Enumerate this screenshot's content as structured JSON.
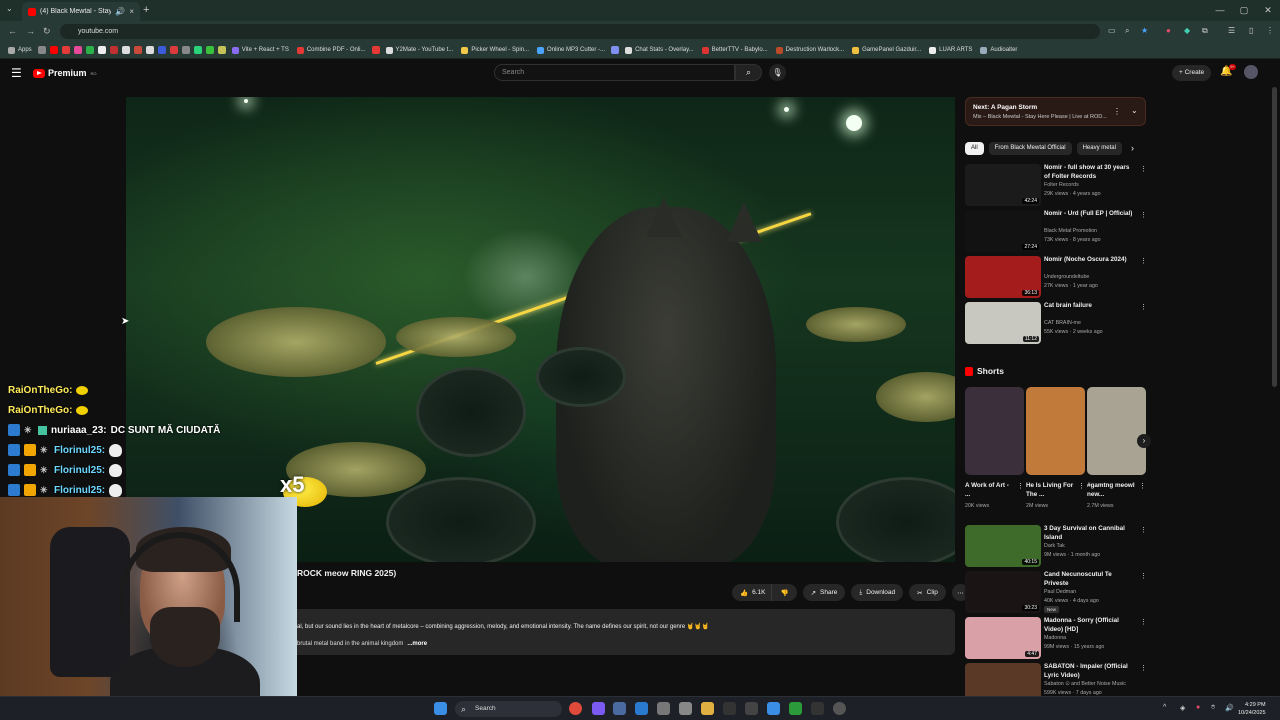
{
  "browser": {
    "tab_title": "(4) Black Mewtal - Stay He...",
    "url": "youtube.com",
    "bookmarks": [
      "Apps",
      "Vite + React + TS",
      "Combine PDF - Onli...",
      "Y2Mate - YouTube t...",
      "Picker Wheel - Spin...",
      "Online MP3 Cutter -...",
      "Chat Stats - Overlay...",
      "BetterTTV - Babylo...",
      "Destruction Warlock...",
      "GamePanel Gazduir...",
      "LUAR ARTS",
      "Audioalter"
    ]
  },
  "youtube": {
    "logo": "Premium",
    "logo_sup": "RO",
    "search_placeholder": "Search",
    "create_label": "Create",
    "notif_count": "9+"
  },
  "video": {
    "title_fragment": "ROCK meow RING 2025)",
    "like_count": "6.1K",
    "share_label": "Share",
    "download_label": "Download",
    "clip_label": "Clip",
    "desc_line1": "al, but our sound lies in the heart of metalcore – combining aggression, melody, and emotional intensity. The name defines our spirit, not our genre 🤘🤘🤘",
    "desc_line2": "brutal metal band in the animal kingdom",
    "desc_more": "...more"
  },
  "chat": [
    {
      "user": "RaiOnTheGo:",
      "msg": "",
      "type": "rai"
    },
    {
      "user": "RaiOnTheGo:",
      "msg": "",
      "type": "rai"
    },
    {
      "user": "nuriaaa_23:",
      "msg": "DC SUNT MĂ CIUDATĂ",
      "type": "nuria"
    },
    {
      "user": "Florinul25:",
      "msg": "",
      "type": "flo"
    },
    {
      "user": "Florinul25:",
      "msg": "",
      "type": "flo"
    },
    {
      "user": "Florinul25:",
      "msg": "",
      "type": "flo"
    }
  ],
  "overlay": {
    "multiplier": "x5"
  },
  "next_up": {
    "label": "Next: A Pagan Storm",
    "sub": "Mix – Black Mewtal - Stay Here Please | Live at ROD..."
  },
  "chips": [
    "All",
    "From Black Mewtal Official",
    "Heavy metal"
  ],
  "recommended_top": [
    {
      "title": "Nomir - full show at 30 years of Folter Records",
      "channel": "Folter Records",
      "meta": "29K views · 4 years ago",
      "duration": "42:24",
      "color": "#1b1b1b"
    },
    {
      "title": "Nomir - Urd (Full EP | Official)",
      "channel": "Black Metal Promotion",
      "meta": "73K views · 8 years ago",
      "duration": "27:24",
      "color": "#121212"
    },
    {
      "title": "Nomir (Noche Oscura 2024)",
      "channel": "Undergroundeltube",
      "meta": "27K views · 1 year ago",
      "duration": "36:13",
      "color": "#a51c1c"
    },
    {
      "title": "Cat brain failure",
      "channel": "CAT BRAIN-me",
      "meta": "55K views · 2 weeks ago",
      "duration": "11:12",
      "color": "#c8c8c0"
    }
  ],
  "shorts": {
    "heading": "Shorts",
    "items": [
      {
        "title": "A Work of Art - ...",
        "views": "20K views",
        "color": "#3a2f3a"
      },
      {
        "title": "He Is Living For The ...",
        "views": "2M views",
        "color": "#c27a3a"
      },
      {
        "title": "#gamtng meowl new...",
        "views": "2.7M views",
        "color": "#a9a393"
      }
    ]
  },
  "recommended_bottom": [
    {
      "title": "3 Day Survival on Cannibal Island",
      "channel": "Dark Tak",
      "meta": "9M views · 1 month ago",
      "duration": "40:15",
      "color": "#3e6a2a",
      "new": ""
    },
    {
      "title": "Cand Necunoscutul Te Priveste",
      "channel": "Paul Dedman",
      "meta": "40K views · 4 days ago",
      "duration": "30:23",
      "color": "#1b1414",
      "new": "New"
    },
    {
      "title": "Madonna - Sorry (Official Video) [HD]",
      "channel": "Madonna",
      "meta": "99M views · 15 years ago",
      "duration": "4:47",
      "color": "#d9a0a8",
      "new": ""
    },
    {
      "title": "SABATON - Impaler (Official Lyric Video)",
      "channel": "Sabaton ⊙ and Better Noise Music",
      "meta": "599K views · 7 days ago",
      "duration": "",
      "color": "#5a3a26",
      "new": ""
    }
  ],
  "taskbar": {
    "search": "Search",
    "time": "4:29 PM",
    "date": "10/24/2025"
  }
}
